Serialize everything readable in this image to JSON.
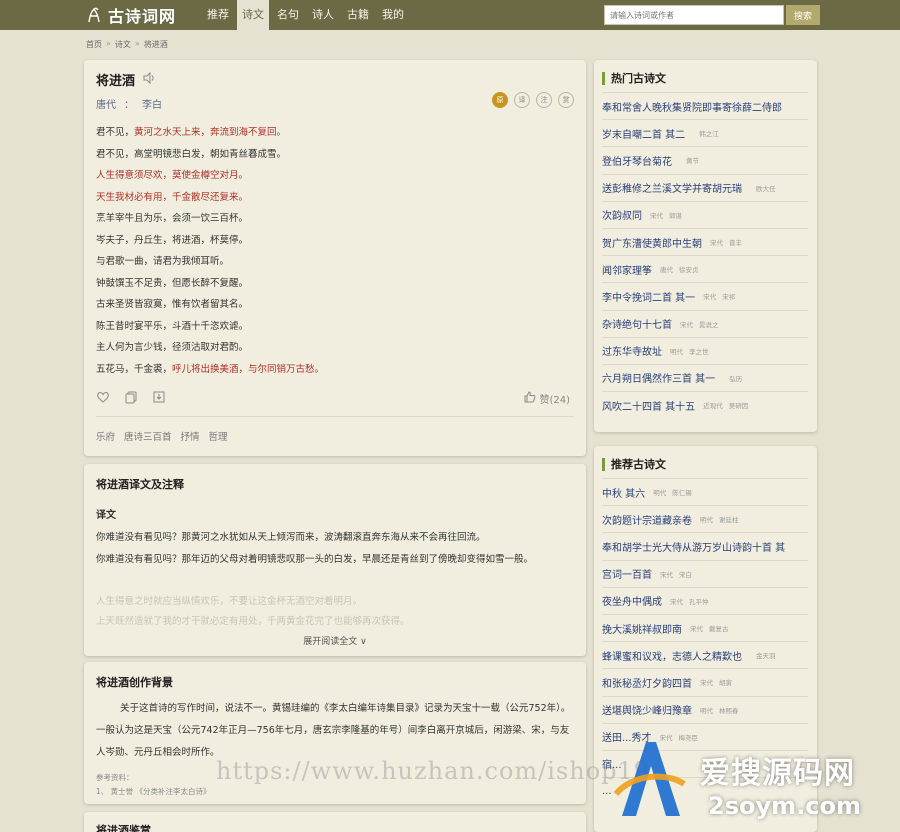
{
  "site": {
    "logo_text": "古诗词网"
  },
  "nav": [
    {
      "label": "推荐",
      "active": false
    },
    {
      "label": "诗文",
      "active": true
    },
    {
      "label": "名句",
      "active": false
    },
    {
      "label": "诗人",
      "active": false
    },
    {
      "label": "古籍",
      "active": false
    },
    {
      "label": "我的",
      "active": false
    }
  ],
  "search": {
    "placeholder": "请输入诗词或作者",
    "button": "搜索"
  },
  "breadcrumb": [
    "首页",
    "诗文",
    "将进酒"
  ],
  "poem": {
    "title": "将进酒",
    "dynasty": "唐代",
    "sep": "：",
    "author": "李白",
    "lang_icons": [
      "原",
      "译",
      "注",
      "赏"
    ],
    "lines": [
      [
        "君不见，",
        "黄河之水天上来，奔流到海不复回。"
      ],
      [
        "君不见，高堂明镜悲白发，朝如青丝暮成雪。",
        ""
      ],
      [
        "",
        "人生得意须尽欢，莫使金樽空对月。"
      ],
      [
        "",
        "天生我材必有用，千金散尽还复来。"
      ],
      [
        "烹羊宰牛且为乐，会须一饮三百杯。",
        ""
      ],
      [
        "岑夫子，丹丘生，将进酒，杯莫停。",
        ""
      ],
      [
        "与君歌一曲，请君为我倾耳听。",
        ""
      ],
      [
        "钟鼓馔玉不足贵，但愿长醉不复醒。",
        ""
      ],
      [
        "古来圣贤皆寂寞，惟有饮者留其名。",
        ""
      ],
      [
        "陈王昔时宴平乐，斗酒十千恣欢谑。",
        ""
      ],
      [
        "主人何为言少钱，径须沽取对君酌。",
        ""
      ],
      [
        "五花马，千金裘，",
        "呼儿将出换美酒，与尔同销万古愁。"
      ]
    ],
    "like_label": "赞(24)",
    "tags": [
      "乐府",
      "唐诗三百首",
      "抒情",
      "哲理"
    ]
  },
  "translation": {
    "title": "将进酒译文及注释",
    "subtitle": "译文",
    "para1": "你难道没有看见吗？那黄河之水犹如从天上倾泻而来，波涛翻滚直奔东海从来不会再往回流。",
    "para2": "你难道没有看见吗？那年迈的父母对着明镜悲叹那一头的白发，早晨还是青丝到了傍晚却变得如雪一般。",
    "para3": "人生得意之时就应当纵情欢乐，不要让这金杯无酒空对着明月。",
    "para4": "上天既然造就了我的才干就必定有用处，千两黄金花完了也能够再次获得。",
    "expand": "展开阅读全文 ∨"
  },
  "background": {
    "title": "将进酒创作背景",
    "text": "关于这首诗的写作时间，说法不一。黄锡珪编的《李太白编年诗集目录》记录为天宝十一载（公元752年）。一般认为这是天宝（公元742年正月—756年七月，唐玄宗李隆基的年号）间李白离开京城后，闲游梁、宋，与友人岑勋、元丹丘相会时所作。",
    "ref_title": "参考资料：",
    "ref_item": "1、 黄士誉 《分类补注李太白诗》"
  },
  "appreciation": {
    "title": "将进酒鉴赏"
  },
  "hot": {
    "title": "热门古诗文",
    "items": [
      {
        "title": "奉和常舍人晚秋集贤院即事寄徐薛二侍郎",
        "dynasty": "",
        "author": ""
      },
      {
        "title": "岁末自嘲二首 其二",
        "dynasty": "",
        "author": "韩之江"
      },
      {
        "title": "登伯牙琴台菊花",
        "dynasty": "",
        "author": "黄节"
      },
      {
        "title": "送彭稚修之兰溪文学并寄胡元瑞",
        "dynasty": "",
        "author": "欧大任"
      },
      {
        "title": "次韵叔同",
        "dynasty": "宋代",
        "author": "郭谌"
      },
      {
        "title": "贺广东漕使黄郎中生朝",
        "dynasty": "宋代",
        "author": "曾丰"
      },
      {
        "title": "闻邻家理筝",
        "dynasty": "唐代",
        "author": "徐安贞"
      },
      {
        "title": "李中令挽词二首 其一",
        "dynasty": "宋代",
        "author": "宋祁"
      },
      {
        "title": "杂诗绝句十七首",
        "dynasty": "宋代",
        "author": "晁说之"
      },
      {
        "title": "过东华寺故址",
        "dynasty": "明代",
        "author": "李之世"
      },
      {
        "title": "六月朔日偶然作三首 其一",
        "dynasty": "",
        "author": "弘历"
      },
      {
        "title": "风吹二十四首 其十五",
        "dynasty": "近现代",
        "author": "吴研因"
      }
    ]
  },
  "recommended": {
    "title": "推荐古诗文",
    "items": [
      {
        "title": "中秋 其六",
        "dynasty": "明代",
        "author": "陈仁锡"
      },
      {
        "title": "次韵题计宗道藏亲卷",
        "dynasty": "明代",
        "author": "谢廷柱"
      },
      {
        "title": "奉和胡学士光大侍从游万岁山诗韵十首 其",
        "dynasty": "",
        "author": ""
      },
      {
        "title": "宫词一百首",
        "dynasty": "宋代",
        "author": "宋白"
      },
      {
        "title": "夜坐舟中偶成",
        "dynasty": "宋代",
        "author": "孔平仲"
      },
      {
        "title": "挽大溪姚祥叔即南",
        "dynasty": "宋代",
        "author": "戴复古"
      },
      {
        "title": "蜂课蜜和议戏，志德人之精歎也",
        "dynasty": "",
        "author": "金天羽"
      },
      {
        "title": "和张秘丞灯夕韵四首",
        "dynasty": "宋代",
        "author": "胡寅"
      },
      {
        "title": "送堪舆饶少峰归豫章",
        "dynasty": "明代",
        "author": "林熙春"
      },
      {
        "title": "送田...秀才",
        "dynasty": "宋代",
        "author": "梅尧臣"
      },
      {
        "title": "宿...",
        "dynasty": "",
        "author": ""
      },
      {
        "title": "...",
        "dynasty": "",
        "author": ""
      }
    ]
  },
  "watermark": {
    "url": "https://www.huzhan.com/ishop19",
    "cn": "爱搜源码网",
    "en": "2soym.com"
  },
  "colors": {
    "topbar": "#6b6a44",
    "highlight": "#b03028",
    "link": "#2a3f78",
    "accent": "#7c9a3a"
  }
}
